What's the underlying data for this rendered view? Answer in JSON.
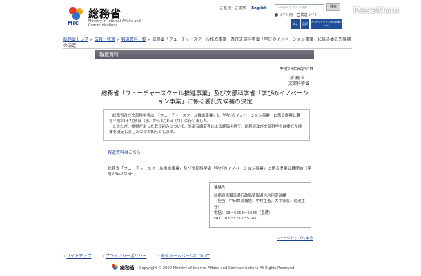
{
  "header": {
    "logo_title": "総務省",
    "logo_mic": "MIC",
    "logo_en": "Ministry of Internal Affairs and Communications",
    "links": [
      "ご意見・ご提案",
      "English"
    ],
    "search_placeholder": "Google カスタム検索",
    "search_button": "検索",
    "radio_options": [
      "サイト内",
      "関連サイト"
    ],
    "tools": [
      "文字",
      "音声",
      "アクセシビリティ閲覧支援ツール"
    ]
  },
  "breadcrumb": {
    "items": [
      "総務省トップ",
      "広報・報道",
      "報道資料一覧"
    ],
    "separator": ">",
    "current": "総務省「フューチャースクール推進事業」及び文部科学省「学びのイノベーション事業」に係る委託先候補の決定"
  },
  "release_bar": "報道資料",
  "date": "平成23年8月30日",
  "org_line1": "総務省",
  "org_line2": "文部科学省",
  "title": "総務省「フューチャースクール推進事業」及び文部科学省「学びのイノベーション事業」に係る委託先候補の決定",
  "summary": {
    "p1": "総務省及び文部科学省は、「フューチャースクール推進事業」と「学びのイノベーション事業」に係る提案公募を平成23年7月6日（水）から8月8日（月）に行いました。",
    "p2": "このたび、提案があった取り組みについて、外部有識者等による評価を経て、総務省及び文部科学省は委託先候補を決定しましたのでお知らせします。"
  },
  "link_data": "報道資料はこちら",
  "announce": "総務省「フューチャースクール推進事業」及び文部科学省「学びのイノベーション事業」に係る提案公募開始（平成23年7月6日）",
  "contact": {
    "heading": "連絡先",
    "dept": "総務省情報流通行政局情報通信利用促進課",
    "staff": "（担当：中田課長補佐、中村主査、大手係長、菊池主任）",
    "tel": "電話：03－5253－5685（直通）",
    "fax": "FAX：03－5253－5745"
  },
  "pagetop": "ページトップへ戻る",
  "footer": {
    "links": [
      "サイトマップ",
      "プライバシーポリシー",
      "当省ホームページについて"
    ],
    "logo_text": "総務省",
    "copyright": "Copyright © 2009 Ministry of Internal Affairs and Communications All Rights Reserved."
  },
  "watermark": "ReseMom",
  "colors": {
    "link": "#1a3f8f",
    "bar": "#65656f",
    "tool": "#1f4f9a"
  }
}
